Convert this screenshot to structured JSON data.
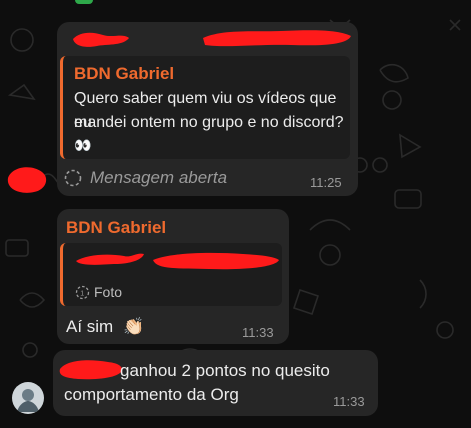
{
  "messages": [
    {
      "quoted_sender": "BDN Gabriel",
      "quoted_text_line1": "Quero saber quem viu os vídeos que eu",
      "quoted_text_line2": "mandei ontem no grupo e no discord?",
      "quoted_emoji": "👀",
      "status_text": "Mensagem aberta",
      "time": "11:25"
    },
    {
      "sender": "BDN Gabriel",
      "quoted_media_label": "Foto",
      "text": "Aí sim",
      "emoji": "👏🏻",
      "time": "11:33"
    },
    {
      "text_line1": "ganhou 2 pontos no quesito",
      "text_line2": "comportamento da Org",
      "time": "11:33"
    }
  ],
  "colors": {
    "background": "#0e0e0e",
    "bubble": "#262626",
    "accent": "#ef6a2e",
    "redaction": "#ff1a1a",
    "timestamp": "#9a9a9a"
  },
  "icons": [
    "dotted-circle-icon",
    "view-once-icon",
    "avatar"
  ]
}
